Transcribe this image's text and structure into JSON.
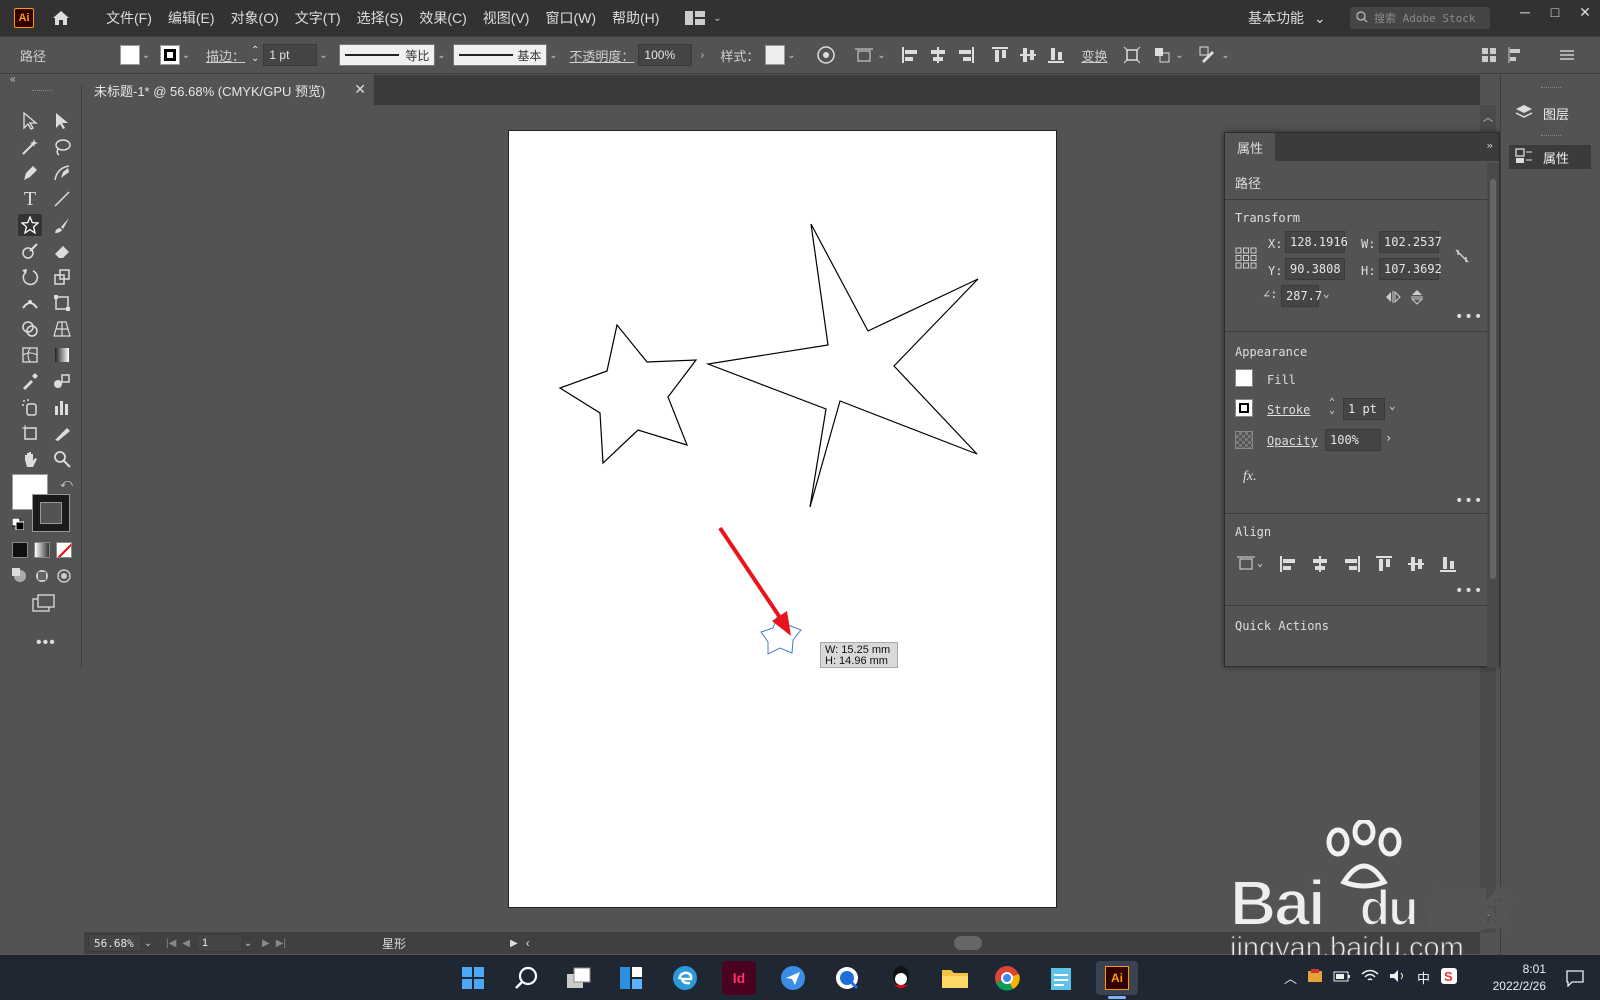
{
  "app": {
    "logo": "Ai",
    "menu": [
      "文件(F)",
      "编辑(E)",
      "对象(O)",
      "文字(T)",
      "选择(S)",
      "效果(C)",
      "视图(V)",
      "窗口(W)",
      "帮助(H)"
    ],
    "workspace": "基本功能",
    "search_placeholder": "搜索 Adobe Stock"
  },
  "control_bar": {
    "selection_type": "路径",
    "stroke_label": "描边：",
    "stroke_weight": "1 pt",
    "profile_label": "等比",
    "brush_label": "基本",
    "opacity_label": "不透明度：",
    "opacity_value": "100%",
    "style_label": "样式：",
    "transform_label": "变换"
  },
  "document": {
    "tab_title": "未标题-1* @ 56.68% (CMYK/GPU 预览)",
    "zoom": "56.68%",
    "artboard_number": "1",
    "status_tool": "星形"
  },
  "tooltip": {
    "width": "W: 15.25 mm",
    "height": "H: 14.96 mm"
  },
  "properties_panel": {
    "tab": "属性",
    "object_type": "路径",
    "transform": {
      "title": "Transform",
      "x_label": "X:",
      "x": "128.1916",
      "y_label": "Y:",
      "y": "90.3808",
      "w_label": "W:",
      "w": "102.2537",
      "h_label": "H:",
      "h": "107.3692",
      "angle": "287.7"
    },
    "appearance": {
      "title": "Appearance",
      "fill": "Fill",
      "stroke": "Stroke",
      "stroke_weight": "1 pt",
      "opacity": "Opacity",
      "opacity_value": "100%",
      "fx": "fx."
    },
    "align_title": "Align",
    "quick_actions": "Quick Actions"
  },
  "right_dock": {
    "layers": "图层",
    "properties": "属性"
  },
  "taskbar": {
    "indesign": "Id",
    "illustrator": "Ai",
    "ime": "中",
    "time": "8:01",
    "date": "2022/2/26"
  },
  "watermark": {
    "brand": "Bai",
    "brand2": "du",
    "suffix": "经验",
    "url": "jingyan.baidu.com"
  },
  "colors": {
    "accent_orange": "#ff9a00",
    "arrow_red": "#e8141b",
    "selection_blue": "#4a78d6"
  }
}
